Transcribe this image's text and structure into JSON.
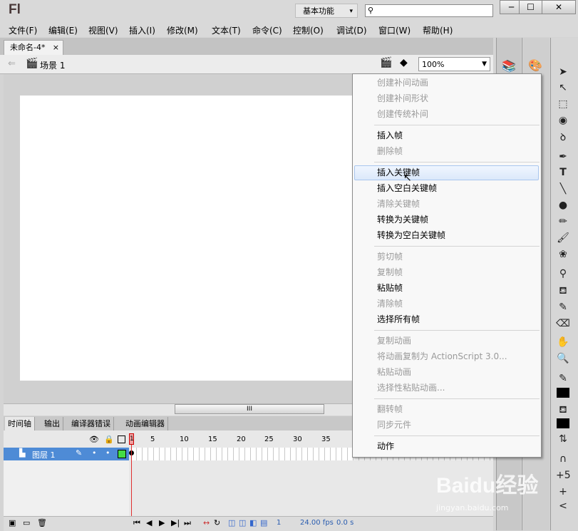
{
  "app": {
    "logo": "Fl",
    "workspace": "基本功能",
    "workspace_arrow": "▾"
  },
  "window_buttons": {
    "minimize": "─",
    "maximize": "☐",
    "close": "✕"
  },
  "menus": [
    "文件(F)",
    "编辑(E)",
    "视图(V)",
    "插入(I)",
    "修改(M)",
    "文本(T)",
    "命令(C)",
    "控制(O)",
    "调试(D)",
    "窗口(W)",
    "帮助(H)"
  ],
  "document": {
    "tab_title": "未命名-4*",
    "tab_close": "×",
    "scene": "场景 1",
    "zoom": "100%"
  },
  "scrollbar_grip": "III",
  "timeline": {
    "tabs": [
      "时间轴",
      "输出",
      "编译器错误",
      "动画编辑器"
    ],
    "frame_numbers": [
      "1",
      "5",
      "10",
      "15",
      "20",
      "25",
      "30",
      "35"
    ],
    "layer_name": "图层 1",
    "current_frame": "1",
    "fps": "24.00 fps",
    "time": "0.0 s"
  },
  "context_menu": {
    "hovered_item": "插入关键帧",
    "groups": [
      [
        {
          "label": "创建补间动画",
          "enabled": false
        },
        {
          "label": "创建补间形状",
          "enabled": false
        },
        {
          "label": "创建传统补间",
          "enabled": false
        }
      ],
      [
        {
          "label": "插入帧",
          "enabled": true
        },
        {
          "label": "删除帧",
          "enabled": false
        }
      ],
      [
        {
          "label": "插入关键帧",
          "enabled": true
        },
        {
          "label": "插入空白关键帧",
          "enabled": true
        },
        {
          "label": "清除关键帧",
          "enabled": false
        },
        {
          "label": "转换为关键帧",
          "enabled": true
        },
        {
          "label": "转换为空白关键帧",
          "enabled": true
        }
      ],
      [
        {
          "label": "剪切帧",
          "enabled": false
        },
        {
          "label": "复制帧",
          "enabled": false
        },
        {
          "label": "粘贴帧",
          "enabled": true
        },
        {
          "label": "清除帧",
          "enabled": false
        },
        {
          "label": "选择所有帧",
          "enabled": true
        }
      ],
      [
        {
          "label": "复制动画",
          "enabled": false
        },
        {
          "label": "将动画复制为 ActionScript 3.0...",
          "enabled": false
        },
        {
          "label": "粘贴动画",
          "enabled": false
        },
        {
          "label": "选择性粘贴动画...",
          "enabled": false
        }
      ],
      [
        {
          "label": "翻转帧",
          "enabled": false
        },
        {
          "label": "同步元件",
          "enabled": false
        }
      ],
      [
        {
          "label": "动作",
          "enabled": true
        }
      ]
    ]
  },
  "watermark": {
    "brand": "Baidu经验",
    "url": "jingyan.baidu.com"
  },
  "colors": {
    "layer_selected": "#4e8bd6",
    "playhead": "#e03030",
    "menu_highlight": "#dbe8fa",
    "disabled_text": "#9a9a9a"
  }
}
